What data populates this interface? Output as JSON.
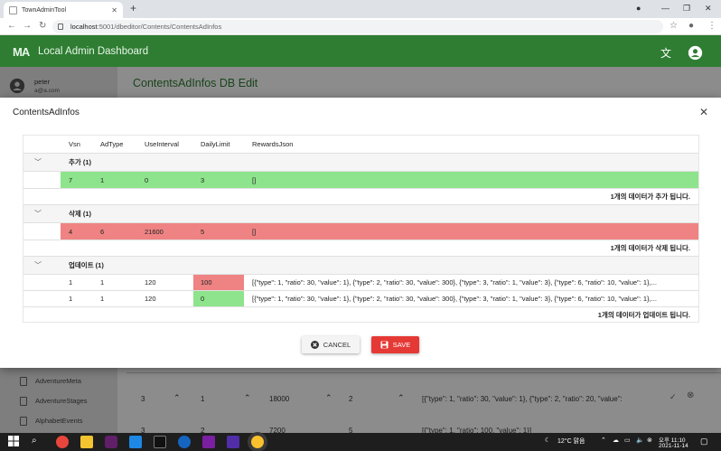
{
  "browser": {
    "tab_title": "TownAdminTool",
    "url_host": "localhost",
    "url_path": ":5001/dbeditor/Contents/ContentsAdInfos"
  },
  "app": {
    "title": "Local Admin Dashboard",
    "user_name": "peter",
    "user_email": "a@a.com",
    "page_heading": "ContentsAdInfos DB Edit",
    "sidebar_items": [
      "AdventureMeta",
      "AdventureStages",
      "AlphabetEvents"
    ],
    "bg_rows": [
      {
        "vsn": "3",
        "adtype": "1",
        "interval": "18000",
        "limit": "2",
        "json": "[{\"type\": 1, \"ratio\": 30, \"value\": 1}, {\"type\": 2, \"ratio\": 20, \"value\":"
      },
      {
        "vsn": "3",
        "adtype": "2",
        "interval": "7200",
        "limit": "5",
        "json": "[{\"type\": 1, \"ratio\": 100, \"value\": 1}]"
      }
    ]
  },
  "dialog": {
    "title": "ContentsAdInfos",
    "columns": [
      "Vsn",
      "AdType",
      "UseInterval",
      "DailyLimit",
      "RewardsJson"
    ],
    "groups": [
      {
        "name": "추가 (1)",
        "rows": [
          {
            "vsn": "7",
            "adtype": "1",
            "interval": "0",
            "limit": "3",
            "json": "[]"
          }
        ],
        "summary": "1개의 데이터가 추가 됩니다."
      },
      {
        "name": "삭제 (1)",
        "rows": [
          {
            "vsn": "4",
            "adtype": "6",
            "interval": "21600",
            "limit": "5",
            "json": "[]"
          }
        ],
        "summary": "1개의 데이터가 삭제 됩니다."
      },
      {
        "name": "업데이트 (1)",
        "rows": [
          {
            "vsn": "1",
            "adtype": "1",
            "interval": "120",
            "limit": "100",
            "json": "[{\"type\": 1, \"ratio\": 30, \"value\": 1}, {\"type\": 2, \"ratio\": 30, \"value\": 300}, {\"type\": 3, \"ratio\": 1, \"value\": 3}, {\"type\": 6, \"ratio\": 10, \"value\": 1},..."
          },
          {
            "vsn": "1",
            "adtype": "1",
            "interval": "120",
            "limit": "0",
            "json": "[{\"type\": 1, \"ratio\": 30, \"value\": 1}, {\"type\": 2, \"ratio\": 30, \"value\": 300}, {\"type\": 3, \"ratio\": 1, \"value\": 3}, {\"type\": 6, \"ratio\": 10, \"value\": 1},..."
          }
        ],
        "summary": "1개의 데이터가 업데이트 됩니다."
      }
    ],
    "cancel_label": "CANCEL",
    "save_label": "SAVE"
  },
  "taskbar": {
    "weather": "12°C 맑음",
    "time": "오후 11:10",
    "date": "2021-11-14"
  },
  "colors": {
    "header_green": "#2e7d32",
    "add_row": "#8ee48c",
    "delete_row": "#ef8383",
    "save_button": "#e53935"
  }
}
